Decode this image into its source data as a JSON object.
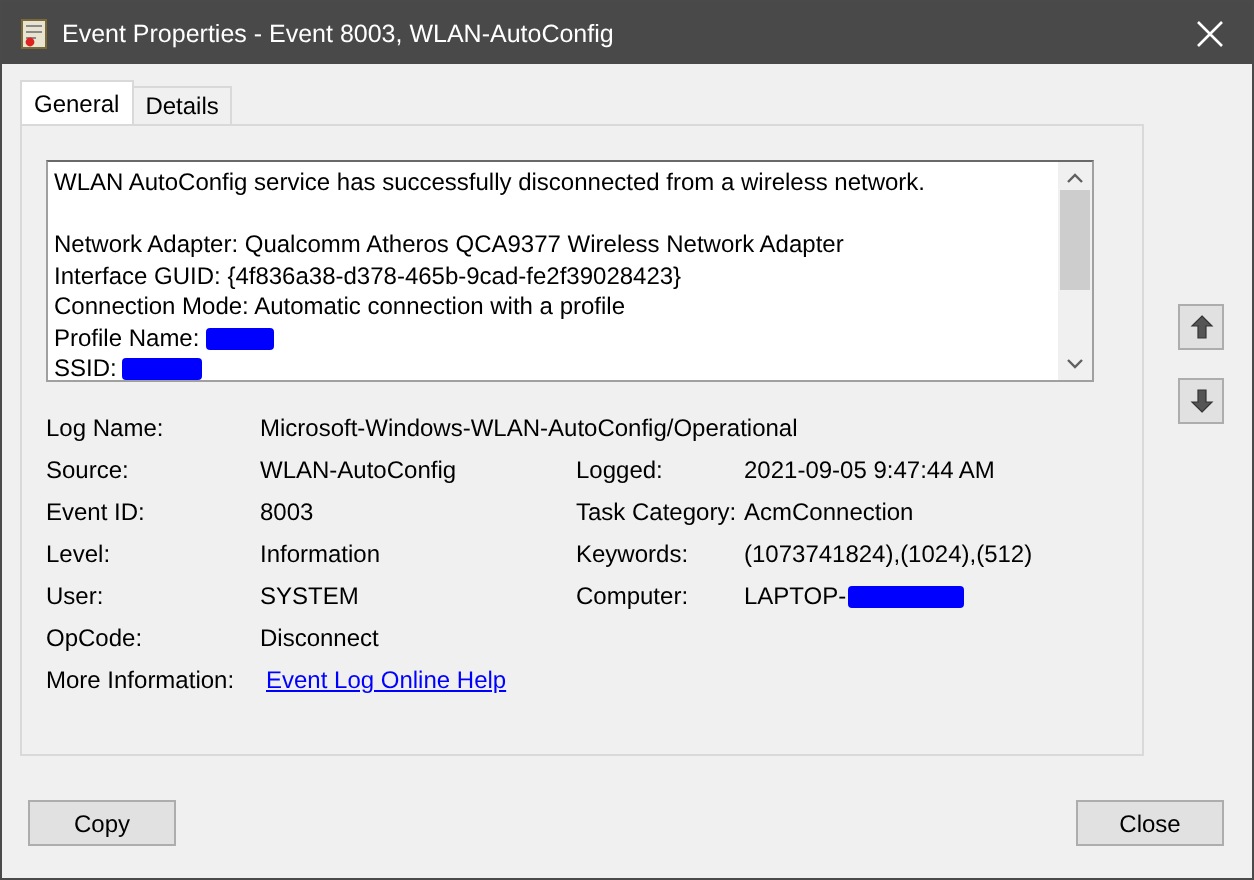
{
  "window": {
    "title": "Event Properties - Event 8003, WLAN-AutoConfig"
  },
  "tabs": [
    {
      "label": "General",
      "selected": true
    },
    {
      "label": "Details",
      "selected": false
    }
  ],
  "message": {
    "lines": [
      {
        "kind": "text",
        "text": "WLAN AutoConfig service has successfully disconnected from a wireless network.",
        "redacted": false
      },
      {
        "kind": "blank"
      },
      {
        "kind": "text",
        "text": "Network Adapter: Qualcomm Atheros QCA9377 Wireless Network Adapter",
        "redacted": false
      },
      {
        "kind": "text",
        "text": "Interface GUID: {4f836a38-d378-465b-9cad-fe2f39028423}",
        "redacted": false
      },
      {
        "kind": "text",
        "text": "Connection Mode: Automatic connection with a profile",
        "redacted": false
      },
      {
        "kind": "text",
        "text": "Profile Name:",
        "redacted": true
      },
      {
        "kind": "text",
        "text": "SSID:",
        "redacted": true
      }
    ]
  },
  "fields": [
    {
      "label": "Log Name:",
      "value": "Microsoft-Windows-WLAN-AutoConfig/Operational",
      "kind": "wide"
    },
    {
      "label": "Source:",
      "value": "WLAN-AutoConfig",
      "kind": "pair",
      "right_label": "Logged:",
      "right_value": "2021-09-05 9:47:44 AM",
      "right_redacted": false
    },
    {
      "label": "Event ID:",
      "value": "8003",
      "kind": "pair",
      "right_label": "Task Category:",
      "right_value": "AcmConnection",
      "right_redacted": false
    },
    {
      "label": "Level:",
      "value": "Information",
      "kind": "pair",
      "right_label": "Keywords:",
      "right_value": "(1073741824),(1024),(512)",
      "right_redacted": false
    },
    {
      "label": "User:",
      "value": "SYSTEM",
      "kind": "pair",
      "right_label": "Computer:",
      "right_value": "LAPTOP-",
      "right_redacted": true
    },
    {
      "label": "OpCode:",
      "value": "Disconnect",
      "kind": "pair-empty"
    },
    {
      "label": "More Information:",
      "value": "Event Log Online Help",
      "kind": "link"
    }
  ],
  "buttons": [
    {
      "label": "Copy"
    },
    {
      "label": "Close"
    }
  ]
}
